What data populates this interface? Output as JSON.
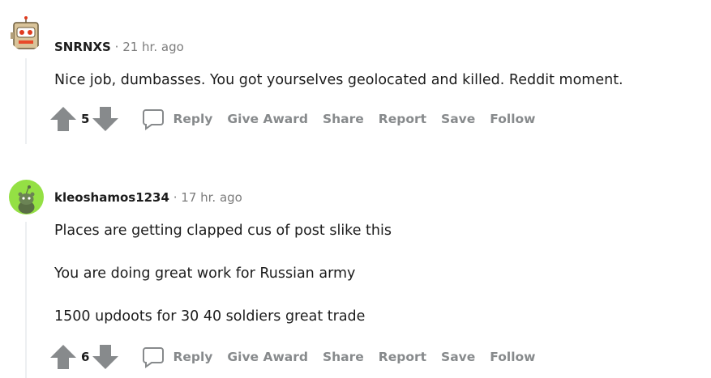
{
  "comments": [
    {
      "username": "SNRNXS",
      "separator": "·",
      "time": "21 hr. ago",
      "avatar": "robot-box-avatar",
      "body": [
        "Nice job, dumbasses. You got yourselves geolocated and killed. Reddit moment."
      ],
      "score": "5",
      "actions": {
        "reply": "Reply",
        "give_award": "Give Award",
        "share": "Share",
        "report": "Report",
        "save": "Save",
        "follow": "Follow"
      }
    },
    {
      "username": "kleoshamos1234",
      "separator": "·",
      "time": "17 hr. ago",
      "avatar": "snoo-avatar",
      "body": [
        "Places are getting clapped cus of post slike this",
        "You are doing great work for Russian army",
        "1500 updoots for 30 40 soldiers great trade"
      ],
      "score": "6",
      "actions": {
        "reply": "Reply",
        "give_award": "Give Award",
        "share": "Share",
        "report": "Report",
        "save": "Save",
        "follow": "Follow"
      }
    }
  ],
  "colors": {
    "meta": "#7c7c7c",
    "action": "#878a8c",
    "thread": "#edeff1",
    "avatar2_bg": "#94e044",
    "arrow": "#878a8c"
  }
}
